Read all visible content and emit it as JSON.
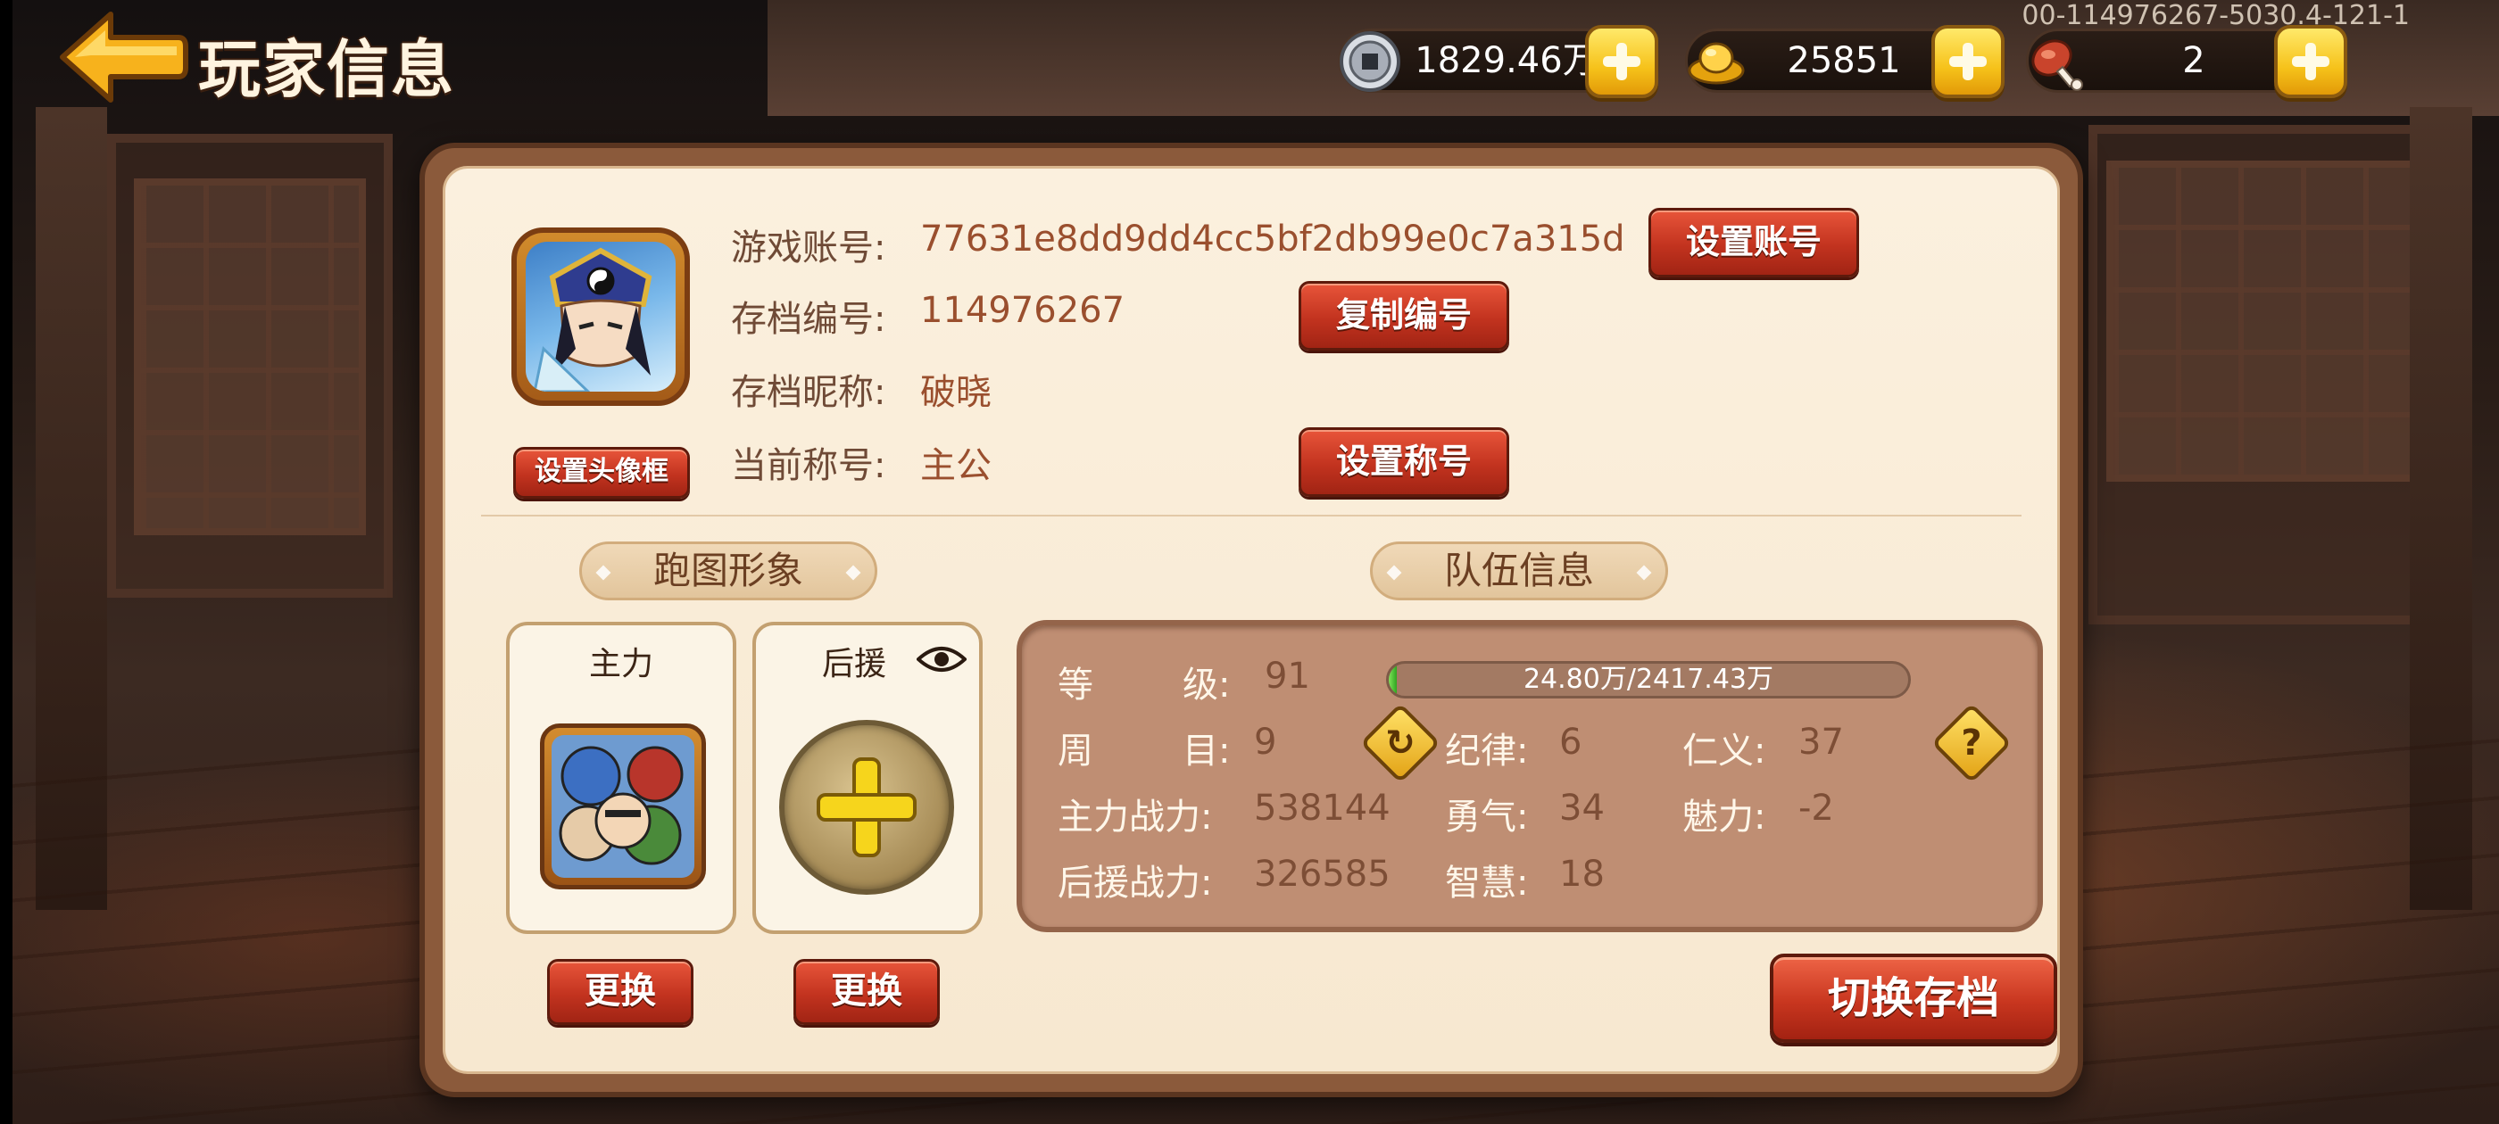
{
  "header": {
    "title": "玩家信息",
    "version": "00-114976267-5030.4-121-1"
  },
  "resources": {
    "coins": "1829.46万",
    "gold": "25851",
    "meat": "2"
  },
  "account": {
    "labels": {
      "account": "游戏账号:",
      "save_id": "存档编号:",
      "nickname": "存档昵称:",
      "title": "当前称号:"
    },
    "values": {
      "account": "77631e8dd9dd4cc5bf2db99e0c7a315d",
      "save_id": "114976267",
      "nickname": "破晓",
      "title": "主公"
    },
    "buttons": {
      "set_account": "设置账号",
      "copy_id": "复制编号",
      "set_title": "设置称号",
      "set_avatar_frame": "设置头像框"
    }
  },
  "map_look": {
    "heading": "跑图形象",
    "main_slot": "主力",
    "support_slot": "后援",
    "change_label": "更换"
  },
  "team": {
    "heading": "队伍信息",
    "level_label_1": "等",
    "level_label_2": "级:",
    "level": "91",
    "exp_text": "24.80万/2417.43万",
    "exp_progress": 0.0103,
    "cycle_label_1": "周",
    "cycle_label_2": "目:",
    "cycle": "9",
    "main_power_label": "主力战力:",
    "main_power": "538144",
    "support_power_label": "后援战力:",
    "support_power": "326585",
    "discipline_label": "纪律:",
    "discipline": "6",
    "courage_label": "勇气:",
    "courage": "34",
    "wisdom_label": "智慧:",
    "wisdom": "18",
    "benevolence_label": "仁义:",
    "benevolence": "37",
    "charm_label": "魅力:",
    "charm": "-2"
  },
  "switch_save": "切换存档",
  "colors": {
    "accent_red": "#c2331f",
    "card_bg": "#fbf0de",
    "team_bg": "#bf8e73",
    "gold": "#f6c21a"
  }
}
